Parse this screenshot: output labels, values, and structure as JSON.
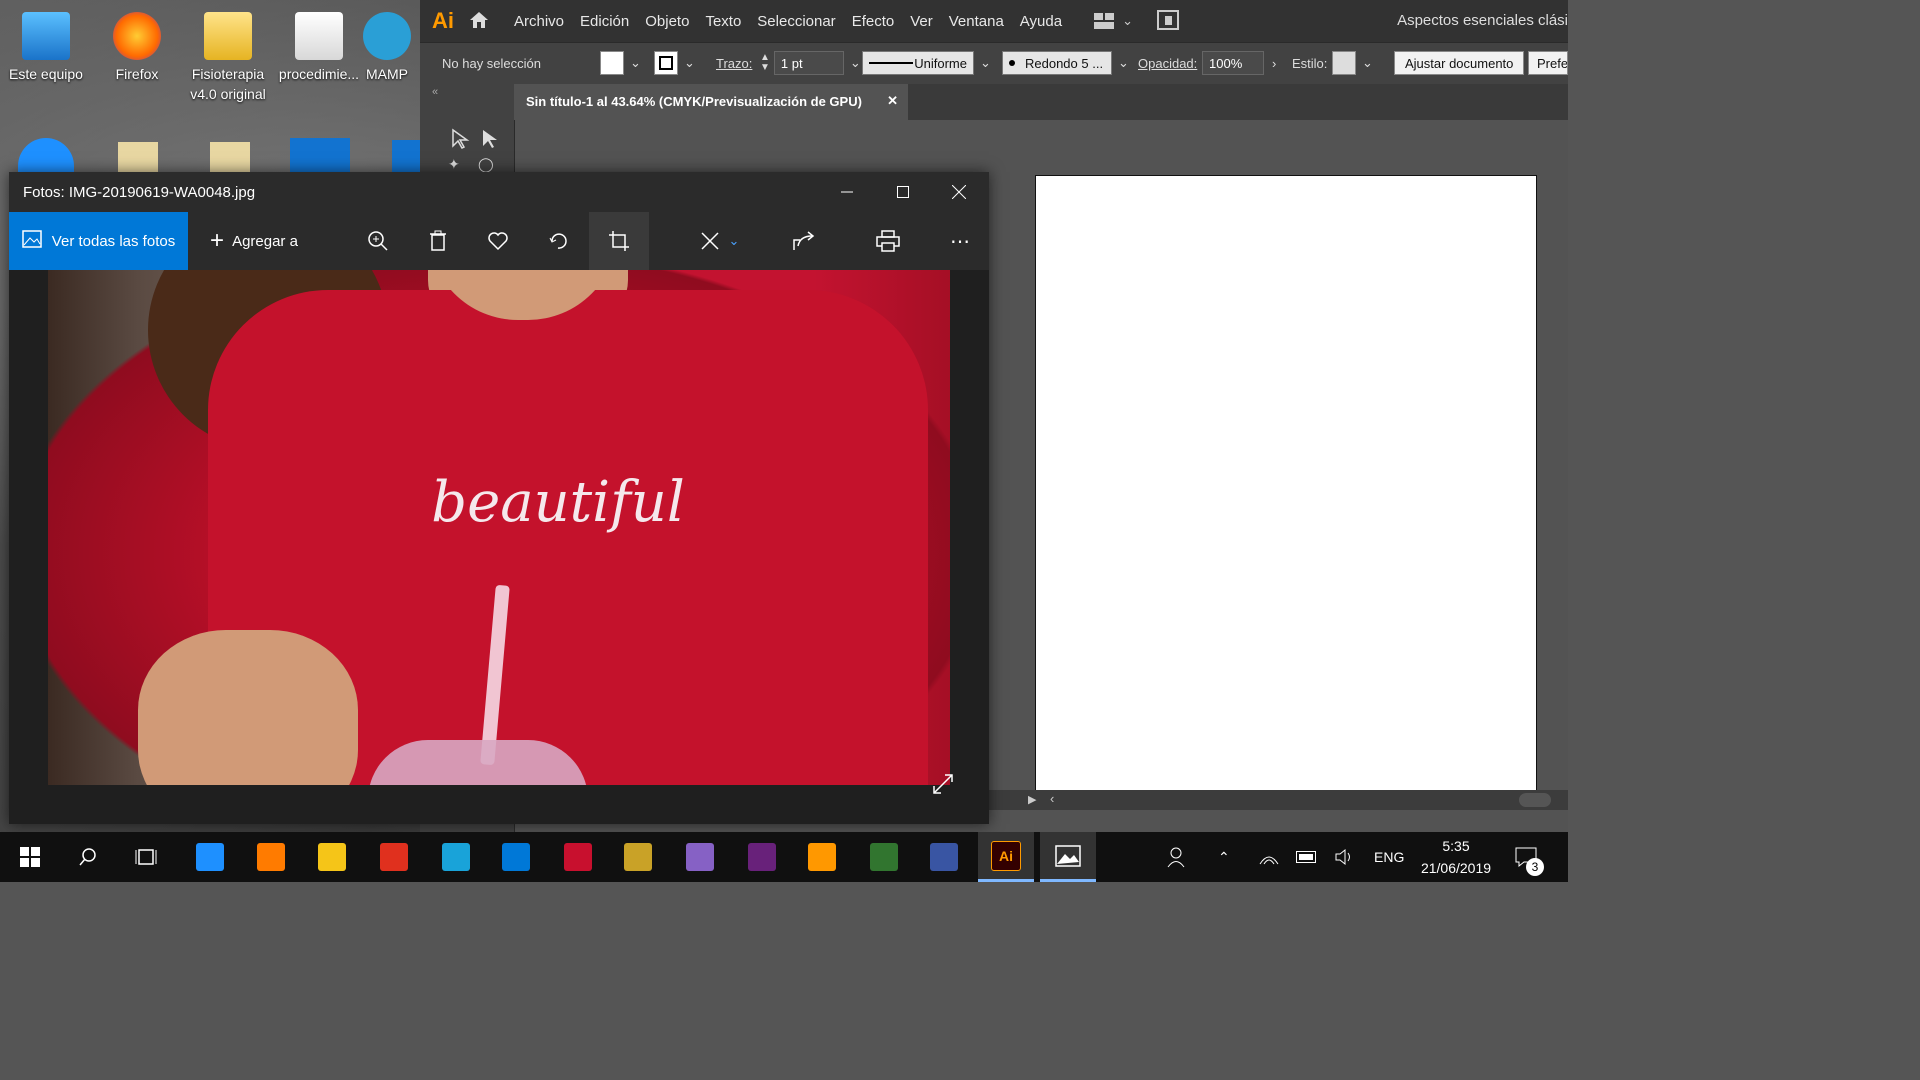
{
  "desktop": {
    "icons": [
      {
        "label": "Este equipo"
      },
      {
        "label": "Firefox"
      },
      {
        "label": "Fisioterapia v4.0 original"
      },
      {
        "label": "procedimie..."
      },
      {
        "label": "MAMP"
      }
    ]
  },
  "illustrator": {
    "logo": "Ai",
    "menu": [
      "Archivo",
      "Edición",
      "Objeto",
      "Texto",
      "Seleccionar",
      "Efecto",
      "Ver",
      "Ventana",
      "Ayuda"
    ],
    "workspace": "Aspectos esenciales clási",
    "control": {
      "selection": "No hay selección",
      "stroke_label": "Trazo:",
      "stroke_value": "1 pt",
      "profile": "Uniforme",
      "brush": "Redondo 5 ...",
      "opacity_label": "Opacidad:",
      "opacity_value": "100%",
      "style_label": "Estilo:",
      "fit_button": "Ajustar documento",
      "prefs_button": "Prefe"
    },
    "tab_title": "Sin título-1 al 43.64% (CMYK/Previsualización de GPU)"
  },
  "photos": {
    "title": "Fotos: IMG-20190619-WA0048.jpg",
    "view_all": "Ver todas las fotos",
    "add_to": "Agregar a",
    "image_text": "beautiful"
  },
  "taskbar": {
    "lang": "ENG",
    "time": "5:35",
    "date": "21/06/2019",
    "notifications": "3",
    "apps": [
      {
        "name": "start",
        "color": "#ffffff"
      },
      {
        "name": "search",
        "color": "#ffffff"
      },
      {
        "name": "task-view",
        "color": "#ffffff"
      },
      {
        "name": "edge",
        "color": "#1e90ff"
      },
      {
        "name": "firefox",
        "color": "#ff7b00"
      },
      {
        "name": "file-explorer",
        "color": "#f5c518"
      },
      {
        "name": "app-red",
        "color": "#e0301e"
      },
      {
        "name": "app-l",
        "color": "#19a3d9"
      },
      {
        "name": "store",
        "color": "#0078d7"
      },
      {
        "name": "mcafee",
        "color": "#c8102e"
      },
      {
        "name": "tools",
        "color": "#c9a227"
      },
      {
        "name": "visual-studio",
        "color": "#8661c5"
      },
      {
        "name": "visual-studio-2",
        "color": "#68217a"
      },
      {
        "name": "sublime",
        "color": "#ff9800"
      },
      {
        "name": "project",
        "color": "#31752f"
      },
      {
        "name": "visio",
        "color": "#3955a3"
      },
      {
        "name": "illustrator",
        "color": "#ff9a00"
      },
      {
        "name": "photos",
        "color": "#ffffff"
      }
    ]
  }
}
